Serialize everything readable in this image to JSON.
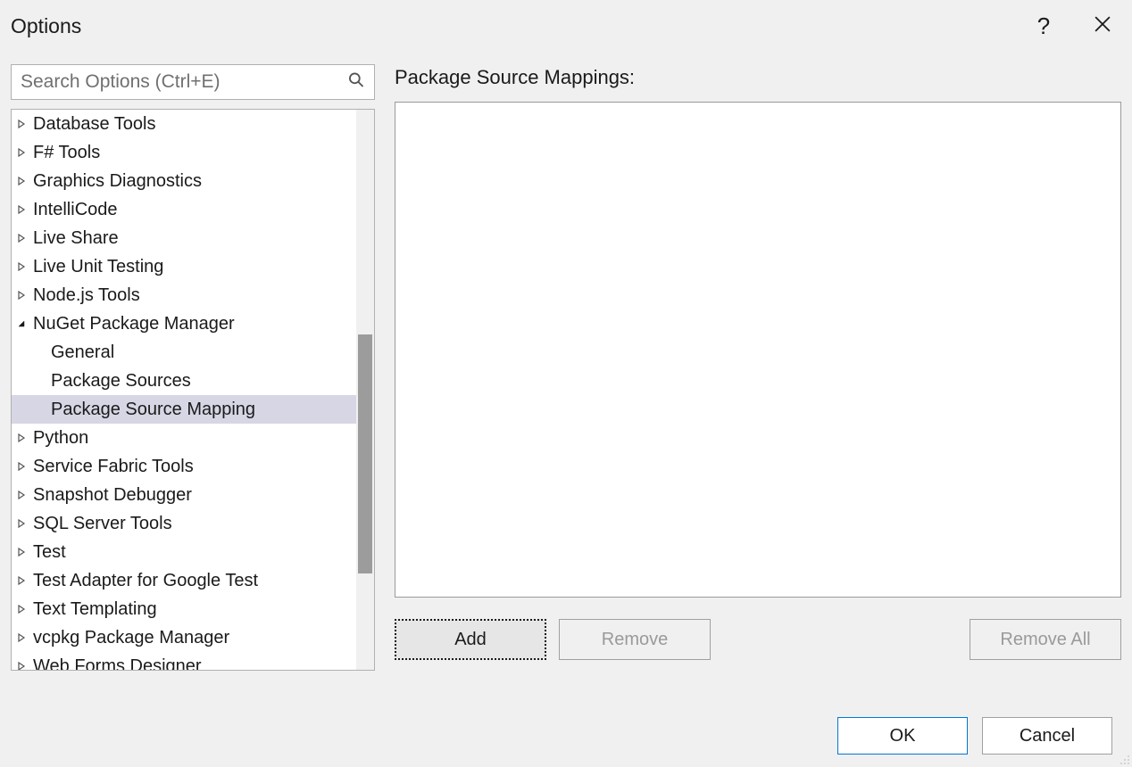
{
  "window": {
    "title": "Options"
  },
  "search": {
    "placeholder": "Search Options (Ctrl+E)"
  },
  "tree": {
    "items": [
      {
        "label": "Database Tools",
        "expanded": false
      },
      {
        "label": "F# Tools",
        "expanded": false
      },
      {
        "label": "Graphics Diagnostics",
        "expanded": false
      },
      {
        "label": "IntelliCode",
        "expanded": false
      },
      {
        "label": "Live Share",
        "expanded": false
      },
      {
        "label": "Live Unit Testing",
        "expanded": false
      },
      {
        "label": "Node.js Tools",
        "expanded": false
      },
      {
        "label": "NuGet Package Manager",
        "expanded": true,
        "children": [
          {
            "label": "General",
            "selected": false
          },
          {
            "label": "Package Sources",
            "selected": false
          },
          {
            "label": "Package Source Mapping",
            "selected": true
          }
        ]
      },
      {
        "label": "Python",
        "expanded": false
      },
      {
        "label": "Service Fabric Tools",
        "expanded": false
      },
      {
        "label": "Snapshot Debugger",
        "expanded": false
      },
      {
        "label": "SQL Server Tools",
        "expanded": false
      },
      {
        "label": "Test",
        "expanded": false
      },
      {
        "label": "Test Adapter for Google Test",
        "expanded": false
      },
      {
        "label": "Text Templating",
        "expanded": false
      },
      {
        "label": "vcpkg Package Manager",
        "expanded": false
      },
      {
        "label": "Web Forms Designer",
        "expanded": false
      }
    ]
  },
  "panel": {
    "heading": "Package Source Mappings:",
    "buttons": {
      "add": "Add",
      "remove": "Remove",
      "removeAll": "Remove All"
    }
  },
  "footer": {
    "ok": "OK",
    "cancel": "Cancel"
  }
}
